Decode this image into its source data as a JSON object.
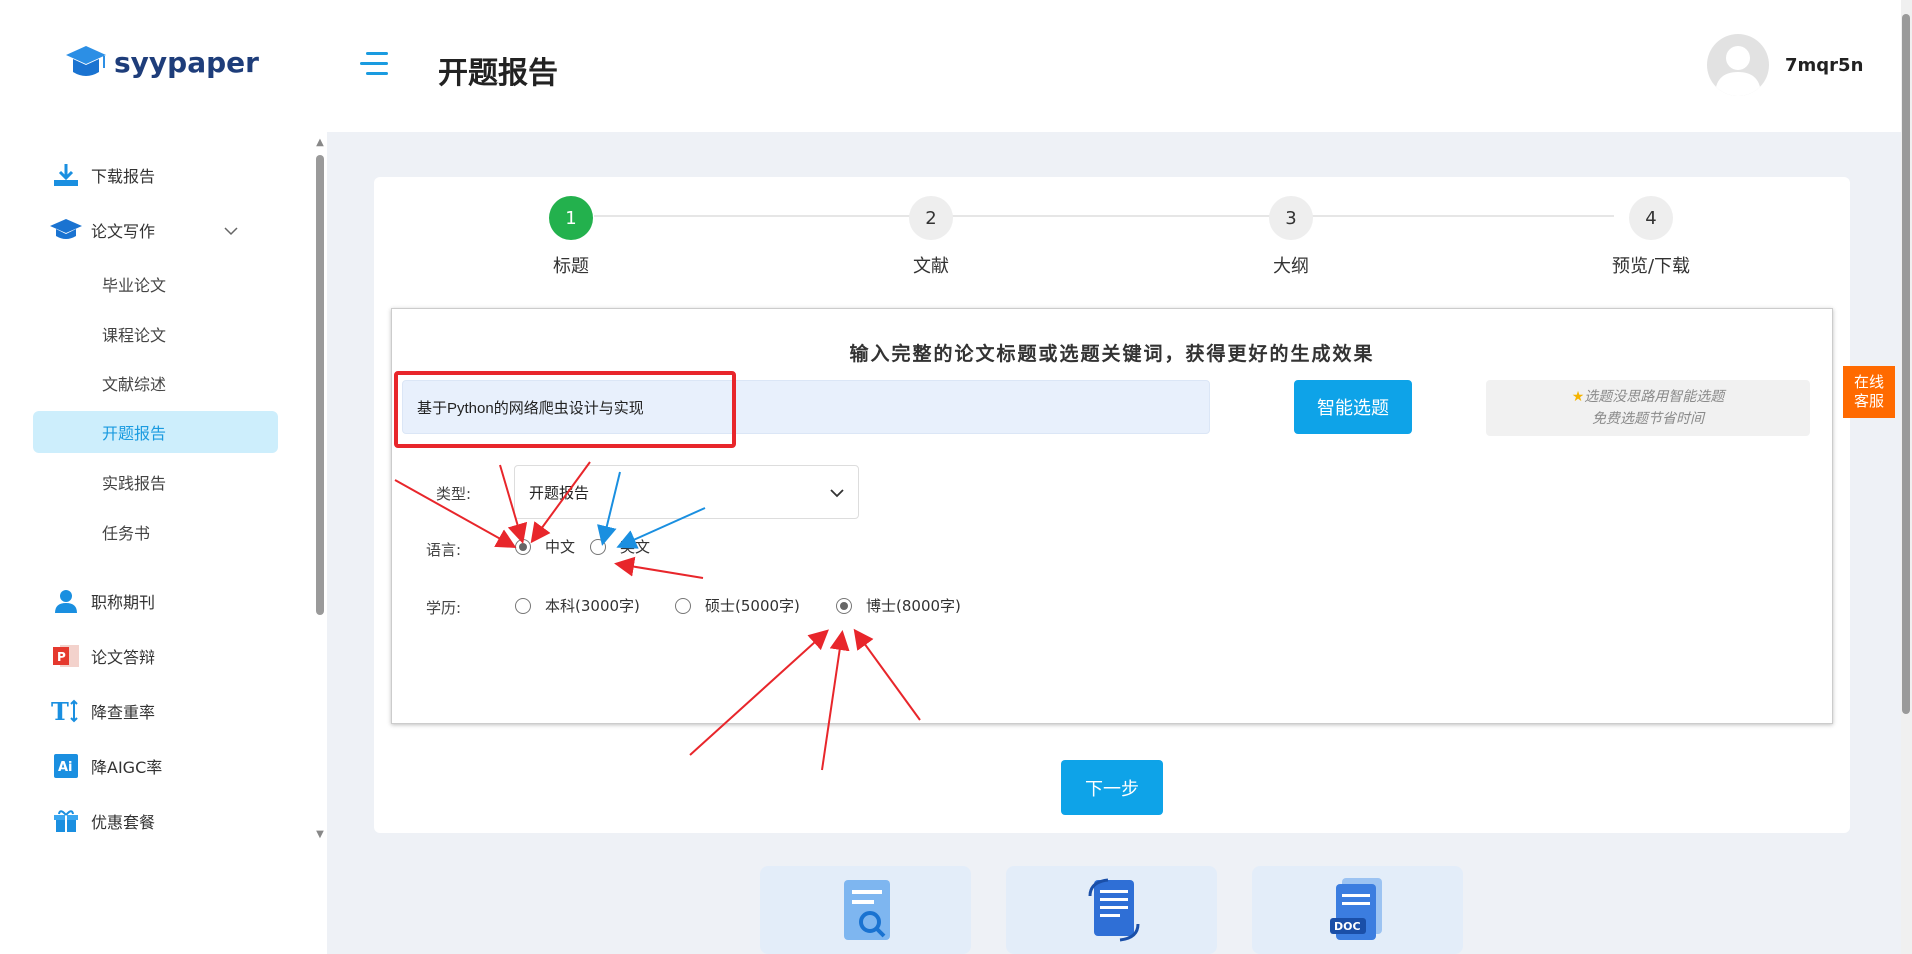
{
  "app": {
    "logo_text": "syypaper"
  },
  "sidebar": {
    "items": [
      {
        "label": "下载报告",
        "icon": "download-icon"
      },
      {
        "label": "论文写作",
        "icon": "graduation-cap-icon"
      },
      {
        "label": "毕业论文"
      },
      {
        "label": "课程论文"
      },
      {
        "label": "文献综述"
      },
      {
        "label": "开题报告",
        "active": true
      },
      {
        "label": "实践报告"
      },
      {
        "label": "任务书"
      },
      {
        "label": "职称期刊",
        "icon": "user-icon"
      },
      {
        "label": "论文答辩",
        "icon": "ppt-icon"
      },
      {
        "label": "降查重率",
        "icon": "text-resize-icon"
      },
      {
        "label": "降AIGC率",
        "icon": "ai-icon"
      },
      {
        "label": "优惠套餐",
        "icon": "gift-icon"
      }
    ]
  },
  "header": {
    "title": "开题报告",
    "username": "7mqr5n"
  },
  "steps": [
    {
      "number": "1",
      "label": "标题",
      "done": true
    },
    {
      "number": "2",
      "label": "文献",
      "done": false
    },
    {
      "number": "3",
      "label": "大纲",
      "done": false
    },
    {
      "number": "4",
      "label": "预览/下载",
      "done": false
    }
  ],
  "form": {
    "heading": "输入完整的论文标题或选题关键词，获得更好的生成效果",
    "title_value": "基于Python的网络爬虫设计与实现",
    "smart_button": "智能选题",
    "hint_line1": "选题没思路用智能选题",
    "hint_line2": "免费选题节省时间",
    "type_label": "类型:",
    "type_value": "开题报告",
    "language_label": "语言:",
    "language_options": [
      {
        "label": "中文",
        "selected": true
      },
      {
        "label": "英文",
        "selected": false
      }
    ],
    "degree_label": "学历:",
    "degree_options": [
      {
        "label": "本科(3000字)",
        "selected": false
      },
      {
        "label": "硕士(5000字)",
        "selected": false
      },
      {
        "label": "博士(8000字)",
        "selected": true
      }
    ]
  },
  "next_button": "下一步",
  "online_service": {
    "line1": "在线",
    "line2": "客服"
  },
  "colors": {
    "accent": "#0ea3e8",
    "step_done": "#23b14d",
    "highlight_red": "#e8262b",
    "service_orange": "#ff6a00",
    "active_nav_bg": "#cdeefc"
  }
}
